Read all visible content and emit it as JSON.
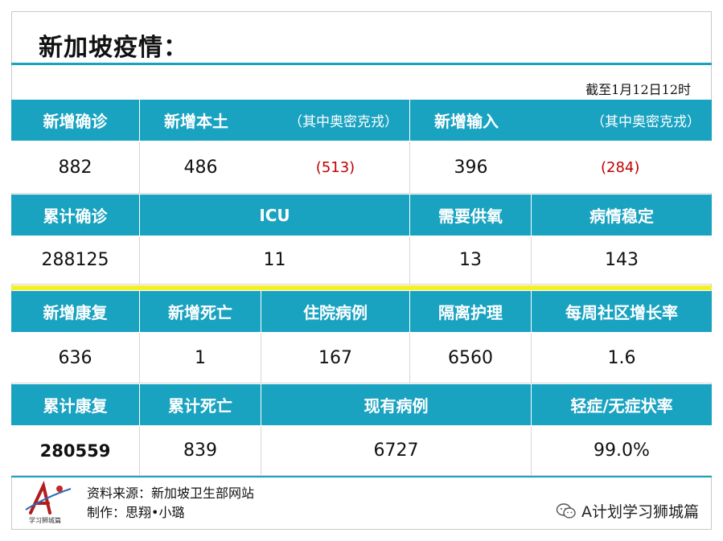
{
  "title": "新加坡疫情：",
  "as_of": "截至1月12日12时",
  "table": {
    "row1": [
      "新增确诊",
      "新增本土",
      "（其中奥密克戎）",
      "新增输入",
      "（其中奥密克戎）"
    ],
    "row2": [
      "882",
      "486",
      "(513)",
      "396",
      "(284)"
    ],
    "row3": [
      "累计确诊",
      "ICU",
      "需要供氧",
      "病情稳定"
    ],
    "row4": [
      "288125",
      "11",
      "13",
      "143"
    ],
    "row5": [
      "新增康复",
      "新增死亡",
      "住院病例",
      "隔离护理",
      "每周社区增长率"
    ],
    "row6": [
      "636",
      "1",
      "167",
      "6560",
      "1.6"
    ],
    "row7": [
      "累计康复",
      "累计死亡",
      "现有病例",
      "轻症/无症状率"
    ],
    "row8": [
      "280559",
      "839",
      "6727",
      "99.0%"
    ]
  },
  "footer": {
    "source": "资料来源：新加坡卫生部网站",
    "credit": "制作：思翔•小璐",
    "logo_caption": "学习狮城篇",
    "wechat_account": "A计划学习狮城篇",
    "wechat_icon": "wechat-icon"
  },
  "colors": {
    "header_bg": "#1aa3c1",
    "divider_yellow": "#f4ef2a",
    "omicron_red": "#c00000"
  }
}
